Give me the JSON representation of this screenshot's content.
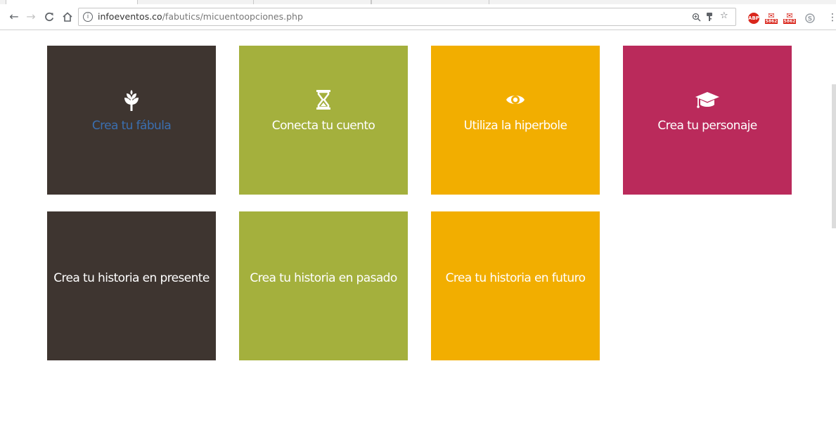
{
  "browser": {
    "url_host": "infoeventos.co",
    "url_path": "/fabutics/micuentoopciones.php",
    "extensions": [
      {
        "name": "abp-icon",
        "label": "ABP"
      },
      {
        "name": "gmail-icon",
        "label": "5862"
      },
      {
        "name": "gmail-icon",
        "label": "5862"
      },
      {
        "name": "skype-icon",
        "label": ""
      }
    ]
  },
  "tiles": [
    {
      "label": "Crea tu fábula",
      "icon": "sprout-icon",
      "color": "#3e3530",
      "text_color": "#3b6fb0"
    },
    {
      "label": "Conecta tu cuento",
      "icon": "hourglass-icon",
      "color": "#a4b03d",
      "text_color": "#ffffff"
    },
    {
      "label": "Utiliza la hiperbole",
      "icon": "eye-icon",
      "color": "#f2ae00",
      "text_color": "#ffffff"
    },
    {
      "label": "Crea tu personaje",
      "icon": "graduation-cap-icon",
      "color": "#ba2a5b",
      "text_color": "#ffffff"
    },
    {
      "label": "Crea tu historia en presente",
      "icon": "",
      "color": "#3e3530",
      "text_color": "#ffffff"
    },
    {
      "label": "Crea tu historia en pasado",
      "icon": "",
      "color": "#a4b03d",
      "text_color": "#ffffff"
    },
    {
      "label": "Crea tu historia en futuro",
      "icon": "",
      "color": "#f2ae00",
      "text_color": "#ffffff"
    }
  ]
}
